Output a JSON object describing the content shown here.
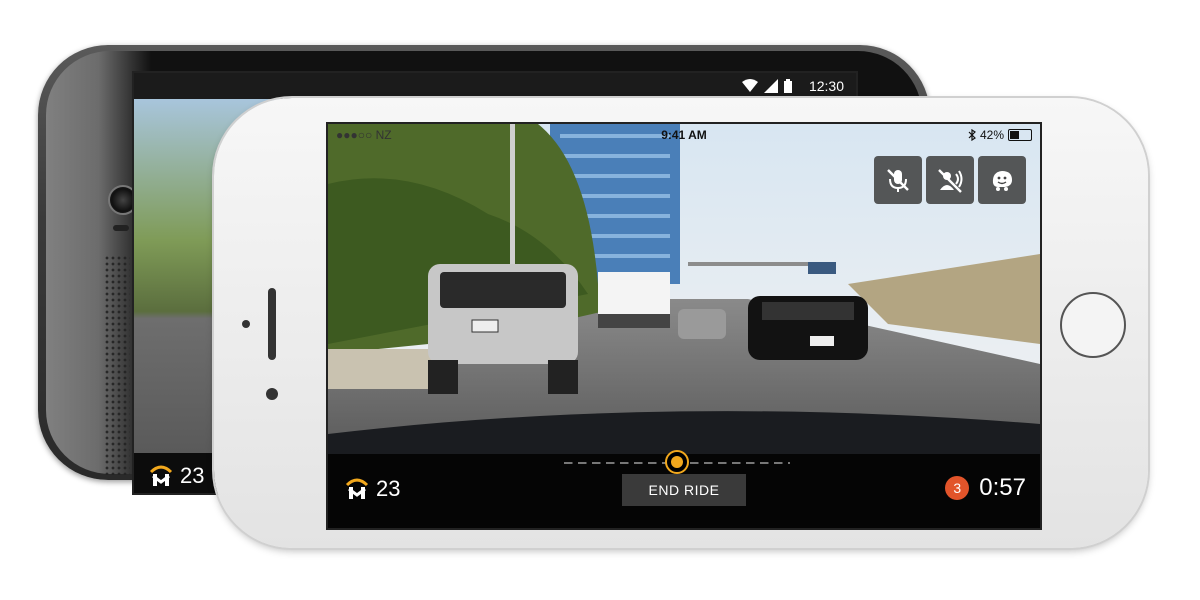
{
  "android": {
    "status_time": "12:30",
    "score": "23",
    "icons": [
      "wifi-icon",
      "signal-icon",
      "battery-icon"
    ]
  },
  "iphone": {
    "status_carrier": "●●●○○ NZ",
    "status_time": "9:41 AM",
    "battery_percent": "42%",
    "controls": [
      "mute-microphone-icon",
      "mute-voice-icon",
      "waze-icon"
    ],
    "score": "23",
    "end_ride_label": "END RIDE",
    "alert_count": "3",
    "timer": "0:57",
    "progress": 0.5
  },
  "colors": {
    "accent": "#f2a81d",
    "alert": "#e2542a",
    "button_bg": "#3a3a3a"
  }
}
